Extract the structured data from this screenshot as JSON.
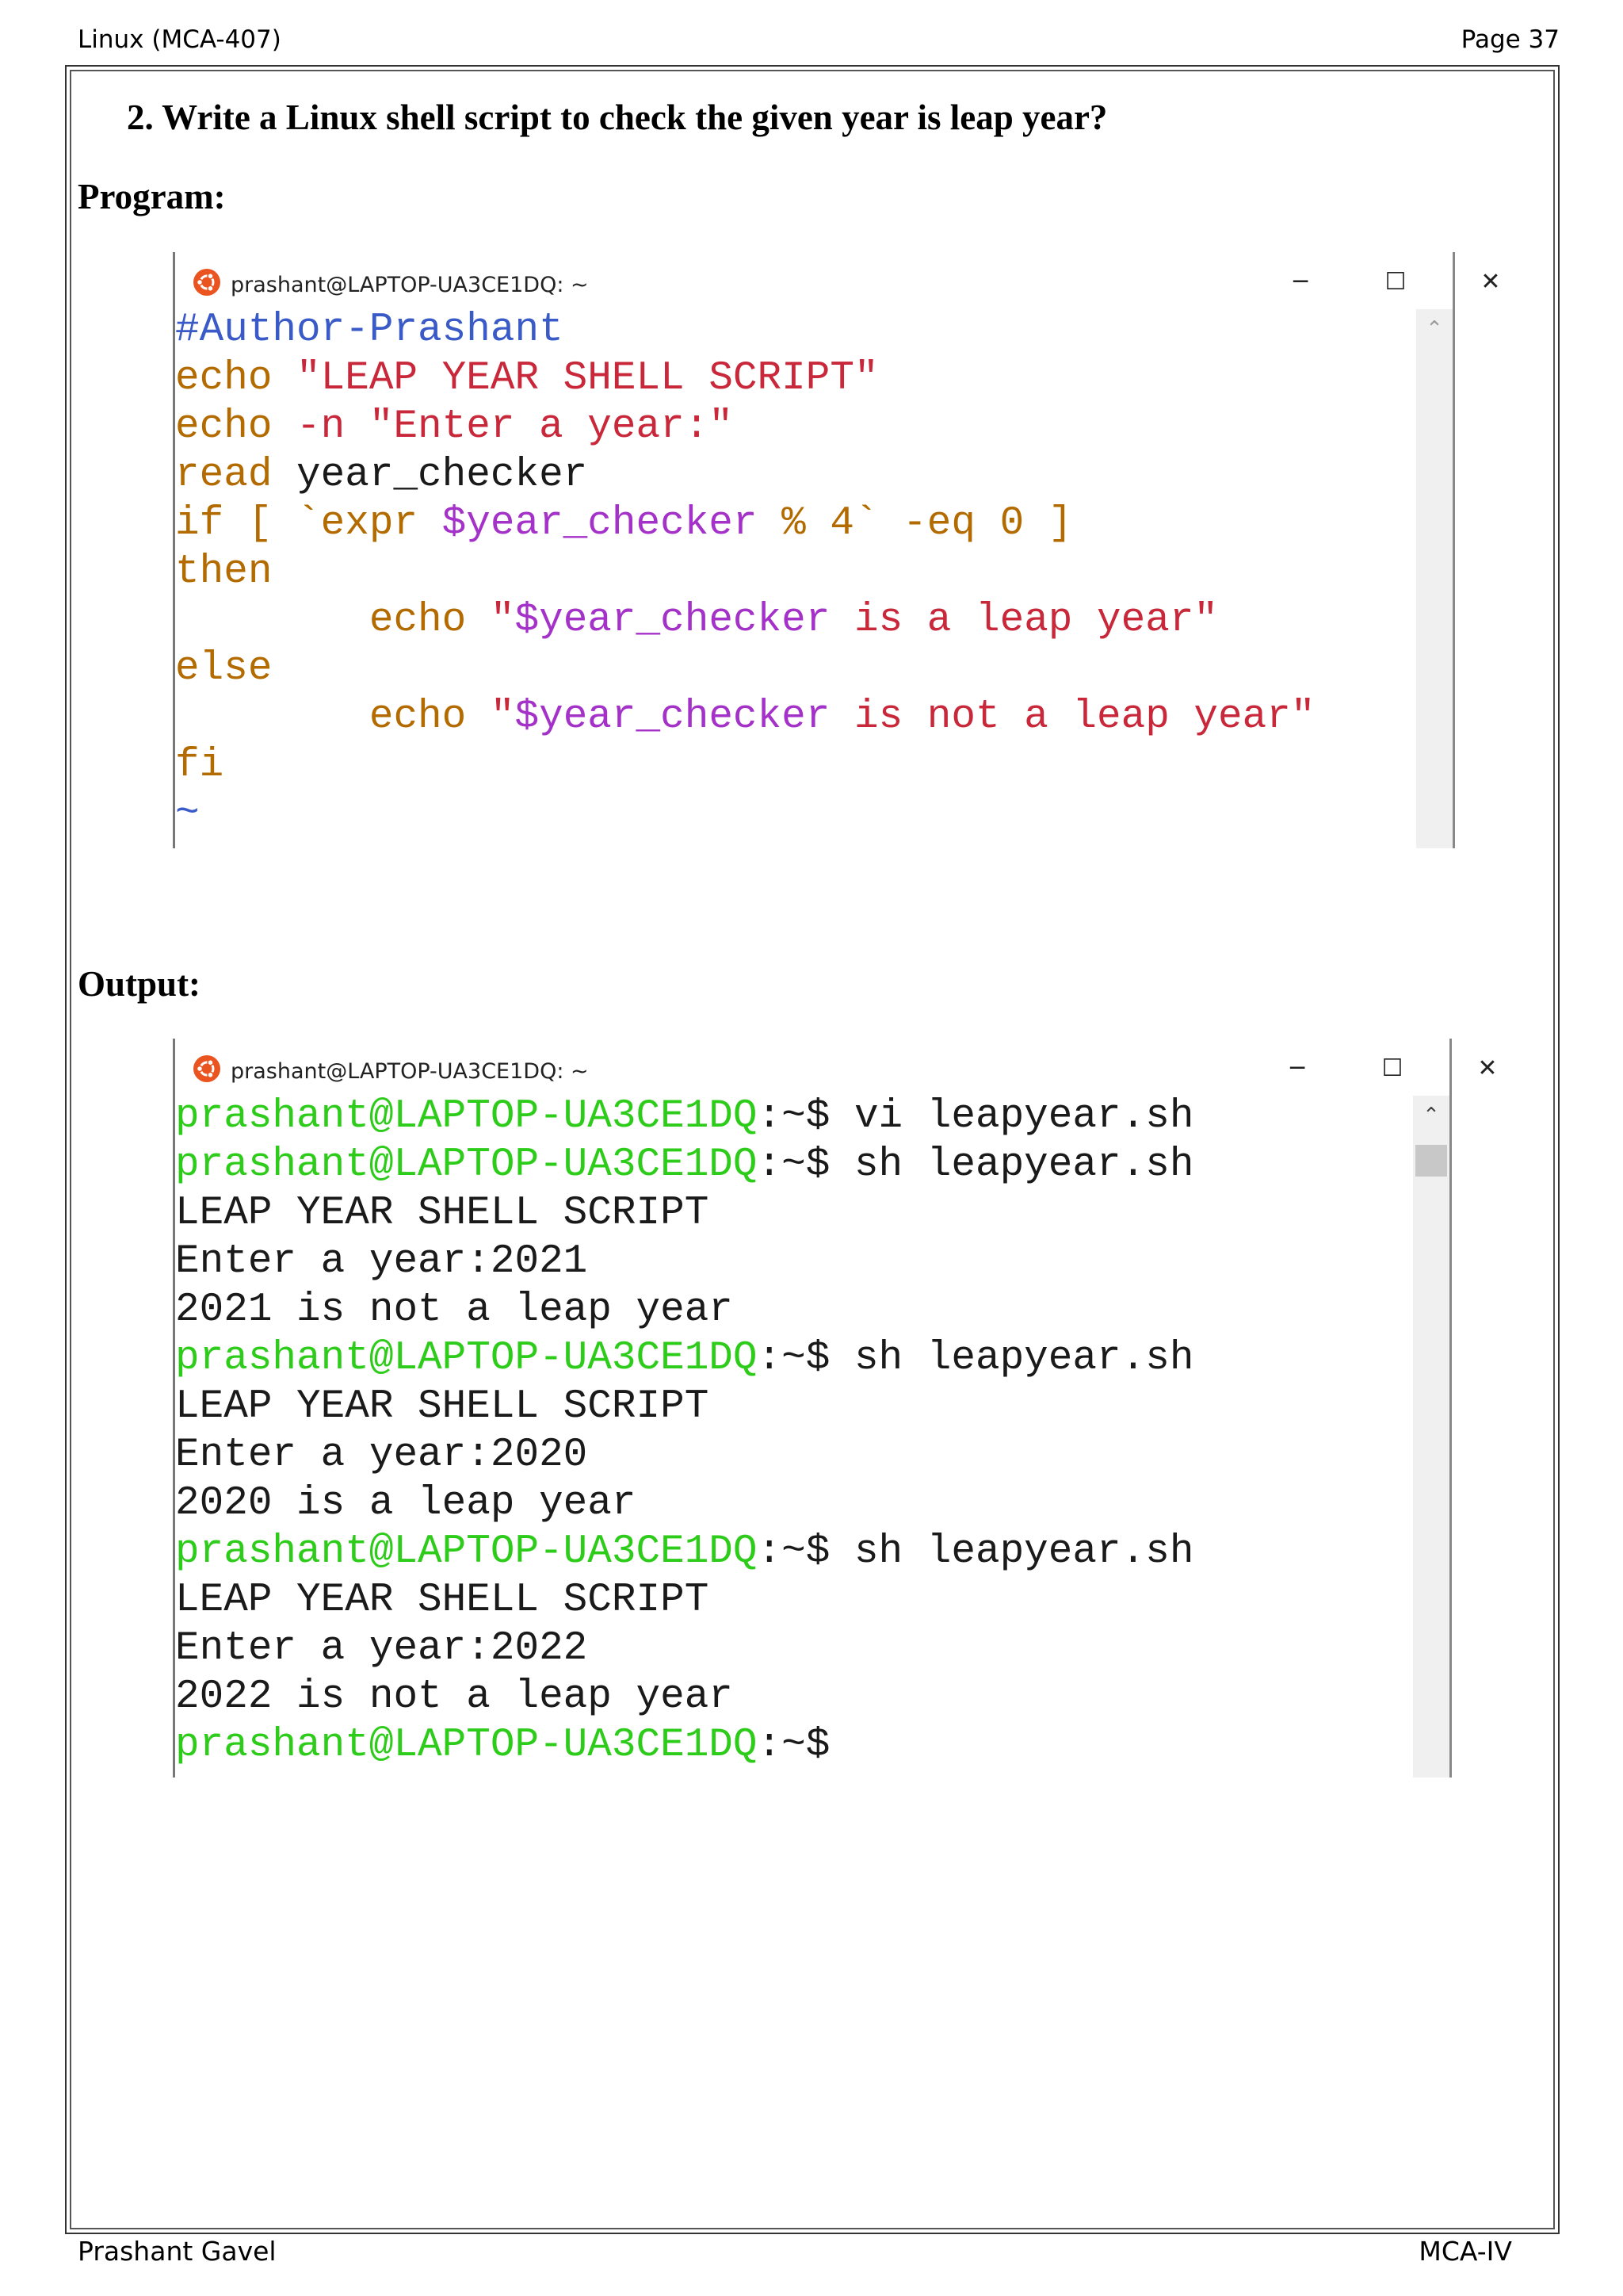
{
  "header": {
    "left": "Linux (MCA-407)",
    "right": "Page 37"
  },
  "question": "2.  Write a Linux shell script to check the given year is leap year?",
  "program_label": "Program:",
  "output_label": "Output:",
  "footer": {
    "left": "Prashant Gavel",
    "right": "MCA-IV"
  },
  "colors": {
    "comment": "#3a5bc7",
    "keyword": "#b36b00",
    "string": "#c8283a",
    "variable": "#a432c8",
    "plain": "#1a1a1a",
    "prompt": "#2ecc1a",
    "tilde": "#3a5bc7"
  },
  "program_window": {
    "title": "prashant@LAPTOP-UA3CE1DQ: ~",
    "minimize": "─",
    "maximize": "☐",
    "close": "✕",
    "scroll_up": "⌃",
    "lines": [
      [
        {
          "t": "#Author-Prashant",
          "c": "comment"
        }
      ],
      [
        {
          "t": "echo",
          "c": "keyword"
        },
        {
          "t": " ",
          "c": "plain"
        },
        {
          "t": "\"LEAP YEAR SHELL SCRIPT\"",
          "c": "string"
        }
      ],
      [
        {
          "t": "echo",
          "c": "keyword"
        },
        {
          "t": " ",
          "c": "plain"
        },
        {
          "t": "-n \"Enter a year:\"",
          "c": "string"
        }
      ],
      [
        {
          "t": "read",
          "c": "keyword"
        },
        {
          "t": " year_checker",
          "c": "plain"
        }
      ],
      [
        {
          "t": "if [ `expr ",
          "c": "keyword"
        },
        {
          "t": "$year_checker",
          "c": "variable"
        },
        {
          "t": " % 4` -eq 0 ]",
          "c": "keyword"
        }
      ],
      [
        {
          "t": "then",
          "c": "keyword"
        }
      ],
      [
        {
          "t": "        ",
          "c": "plain"
        },
        {
          "t": "echo",
          "c": "keyword"
        },
        {
          "t": " \"",
          "c": "string"
        },
        {
          "t": "$year_checker",
          "c": "variable"
        },
        {
          "t": " is a leap year\"",
          "c": "string"
        }
      ],
      [
        {
          "t": "else",
          "c": "keyword"
        }
      ],
      [
        {
          "t": "        ",
          "c": "plain"
        },
        {
          "t": "echo",
          "c": "keyword"
        },
        {
          "t": " \"",
          "c": "string"
        },
        {
          "t": "$year_checker",
          "c": "variable"
        },
        {
          "t": " is not a leap year\"",
          "c": "string"
        }
      ],
      [
        {
          "t": "fi",
          "c": "keyword"
        }
      ],
      [
        {
          "t": "~",
          "c": "tilde"
        }
      ]
    ]
  },
  "output_window": {
    "title": "prashant@LAPTOP-UA3CE1DQ: ~",
    "minimize": "─",
    "maximize": "☐",
    "close": "✕",
    "scroll_up": "⌃",
    "lines": [
      [
        {
          "t": "prashant@LAPTOP-UA3CE1DQ",
          "c": "prompt"
        },
        {
          "t": ":~$ vi leapyear.sh",
          "c": "plain"
        }
      ],
      [
        {
          "t": "prashant@LAPTOP-UA3CE1DQ",
          "c": "prompt"
        },
        {
          "t": ":~$ sh leapyear.sh",
          "c": "plain"
        }
      ],
      [
        {
          "t": "LEAP YEAR SHELL SCRIPT",
          "c": "plain"
        }
      ],
      [
        {
          "t": "Enter a year:2021",
          "c": "plain"
        }
      ],
      [
        {
          "t": "2021 is not a leap year",
          "c": "plain"
        }
      ],
      [
        {
          "t": "prashant@LAPTOP-UA3CE1DQ",
          "c": "prompt"
        },
        {
          "t": ":~$ sh leapyear.sh",
          "c": "plain"
        }
      ],
      [
        {
          "t": "LEAP YEAR SHELL SCRIPT",
          "c": "plain"
        }
      ],
      [
        {
          "t": "Enter a year:2020",
          "c": "plain"
        }
      ],
      [
        {
          "t": "2020 is a leap year",
          "c": "plain"
        }
      ],
      [
        {
          "t": "prashant@LAPTOP-UA3CE1DQ",
          "c": "prompt"
        },
        {
          "t": ":~$ sh leapyear.sh",
          "c": "plain"
        }
      ],
      [
        {
          "t": "LEAP YEAR SHELL SCRIPT",
          "c": "plain"
        }
      ],
      [
        {
          "t": "Enter a year:2022",
          "c": "plain"
        }
      ],
      [
        {
          "t": "2022 is not a leap year",
          "c": "plain"
        }
      ],
      [
        {
          "t": "prashant@LAPTOP-UA3CE1DQ",
          "c": "prompt"
        },
        {
          "t": ":~$",
          "c": "plain"
        }
      ]
    ]
  }
}
